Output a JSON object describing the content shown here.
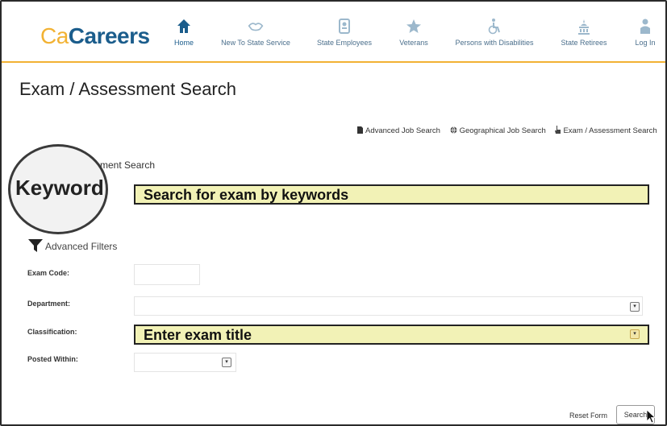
{
  "header": {
    "logo_ca": "Ca",
    "logo_careers": "Careers",
    "nav": [
      {
        "label": "Home",
        "icon": "home-icon"
      },
      {
        "label": "New To State Service",
        "icon": "handshake-icon"
      },
      {
        "label": "State Employees",
        "icon": "badge-icon"
      },
      {
        "label": "Veterans",
        "icon": "star-icon"
      },
      {
        "label": "Persons with Disabilities",
        "icon": "wheelchair-icon"
      },
      {
        "label": "State Retirees",
        "icon": "capitol-icon"
      },
      {
        "label": "Log In",
        "icon": "person-icon"
      }
    ]
  },
  "page": {
    "title": "Exam / Assessment Search",
    "quick_links": [
      {
        "label": "Advanced Job Search",
        "icon": "document-icon"
      },
      {
        "label": "Geographical Job Search",
        "icon": "globe-icon"
      },
      {
        "label": "Exam / Assessment Search",
        "icon": "hand-pointer-icon"
      }
    ],
    "section_title": "ssment Search"
  },
  "annotations": {
    "magnifier_text": "Keyword:",
    "keyword_box": "Search for exam by keywords",
    "classification_box": "Enter exam title"
  },
  "filters": {
    "heading": "Advanced Filters",
    "exam_code": "Exam Code:",
    "department": "Department:",
    "classification": "Classification:",
    "posted_within": "Posted Within:"
  },
  "actions": {
    "reset": "Reset Form",
    "search": "Search"
  },
  "colors": {
    "brand_blue": "#1b5d8c",
    "brand_gold": "#f2b233",
    "highlight": "#f2f2b6"
  }
}
